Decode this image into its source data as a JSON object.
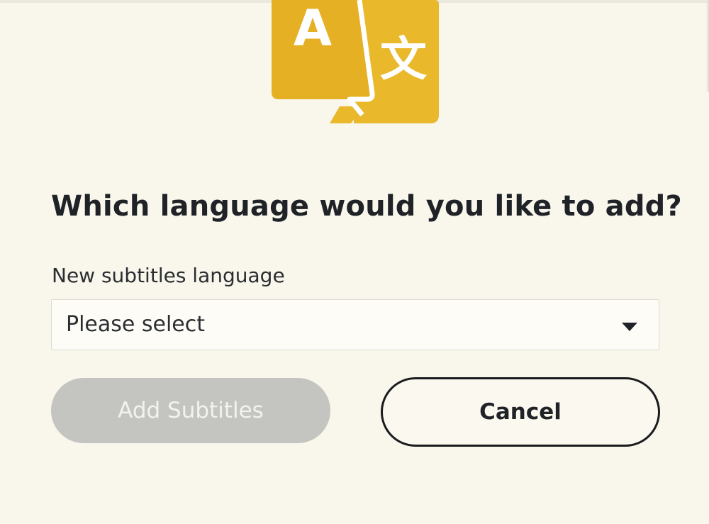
{
  "dialog": {
    "icon": "translate-icon",
    "icon_letters": {
      "left": "A",
      "right": "文"
    },
    "title": "Which language would you like to add?",
    "language_field": {
      "label": "New subtitles language",
      "selected_value": "Please select"
    },
    "buttons": {
      "add_label": "Add Subtitles",
      "add_state": "disabled",
      "cancel_label": "Cancel"
    }
  },
  "colors": {
    "background": "#f9f6ec",
    "icon_yellow": "#e8b82b",
    "icon_yellow_dark": "#d9a91c",
    "title_text": "#1f2327",
    "disabled_button": "#c4c4c0",
    "cancel_border": "#1a1c1e"
  }
}
